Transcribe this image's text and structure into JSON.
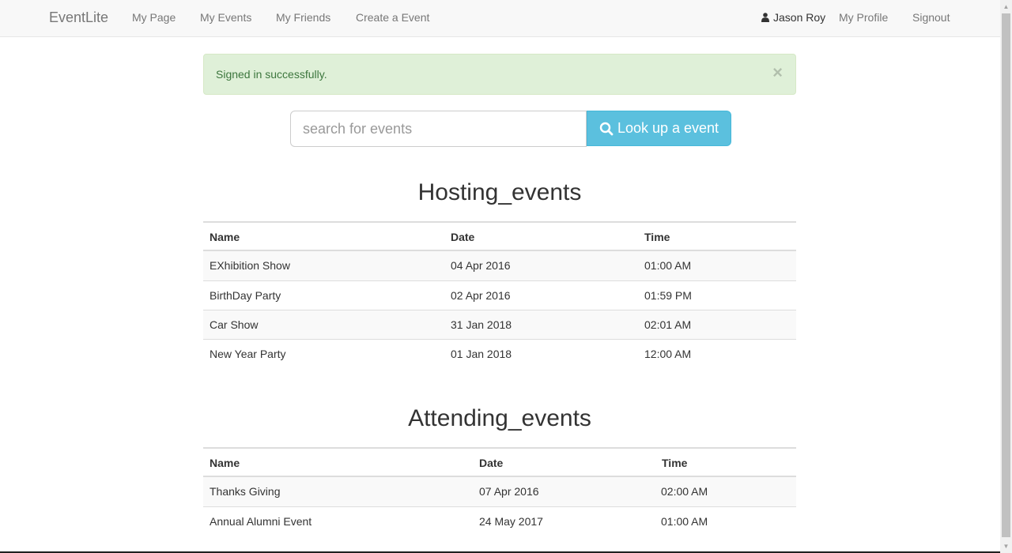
{
  "navbar": {
    "brand": "EventLite",
    "links": [
      "My Page",
      "My Events",
      "My Friends",
      "Create a Event"
    ],
    "user_name": "Jason Roy",
    "profile_label": "My Profile",
    "signout_label": "Signout"
  },
  "alert": {
    "message": "Signed in successfully.",
    "close_symbol": "×"
  },
  "search": {
    "placeholder": "search for events",
    "button_label": "Look up a event"
  },
  "hosting": {
    "title": "Hosting_events",
    "columns": [
      "Name",
      "Date",
      "Time"
    ],
    "rows": [
      {
        "name": "EXhibition Show",
        "date": "04 Apr 2016",
        "time": "01:00 AM"
      },
      {
        "name": "BirthDay Party",
        "date": "02 Apr 2016",
        "time": "01:59 PM"
      },
      {
        "name": "Car Show",
        "date": "31 Jan 2018",
        "time": "02:01 AM"
      },
      {
        "name": "New Year Party",
        "date": "01 Jan 2018",
        "time": "12:00 AM"
      }
    ]
  },
  "attending": {
    "title": "Attending_events",
    "columns": [
      "Name",
      "Date",
      "Time"
    ],
    "rows": [
      {
        "name": "Thanks Giving",
        "date": "07 Apr 2016",
        "time": "02:00 AM"
      },
      {
        "name": "Annual Alumni Event",
        "date": "24 May 2017",
        "time": "01:00 AM"
      }
    ]
  }
}
